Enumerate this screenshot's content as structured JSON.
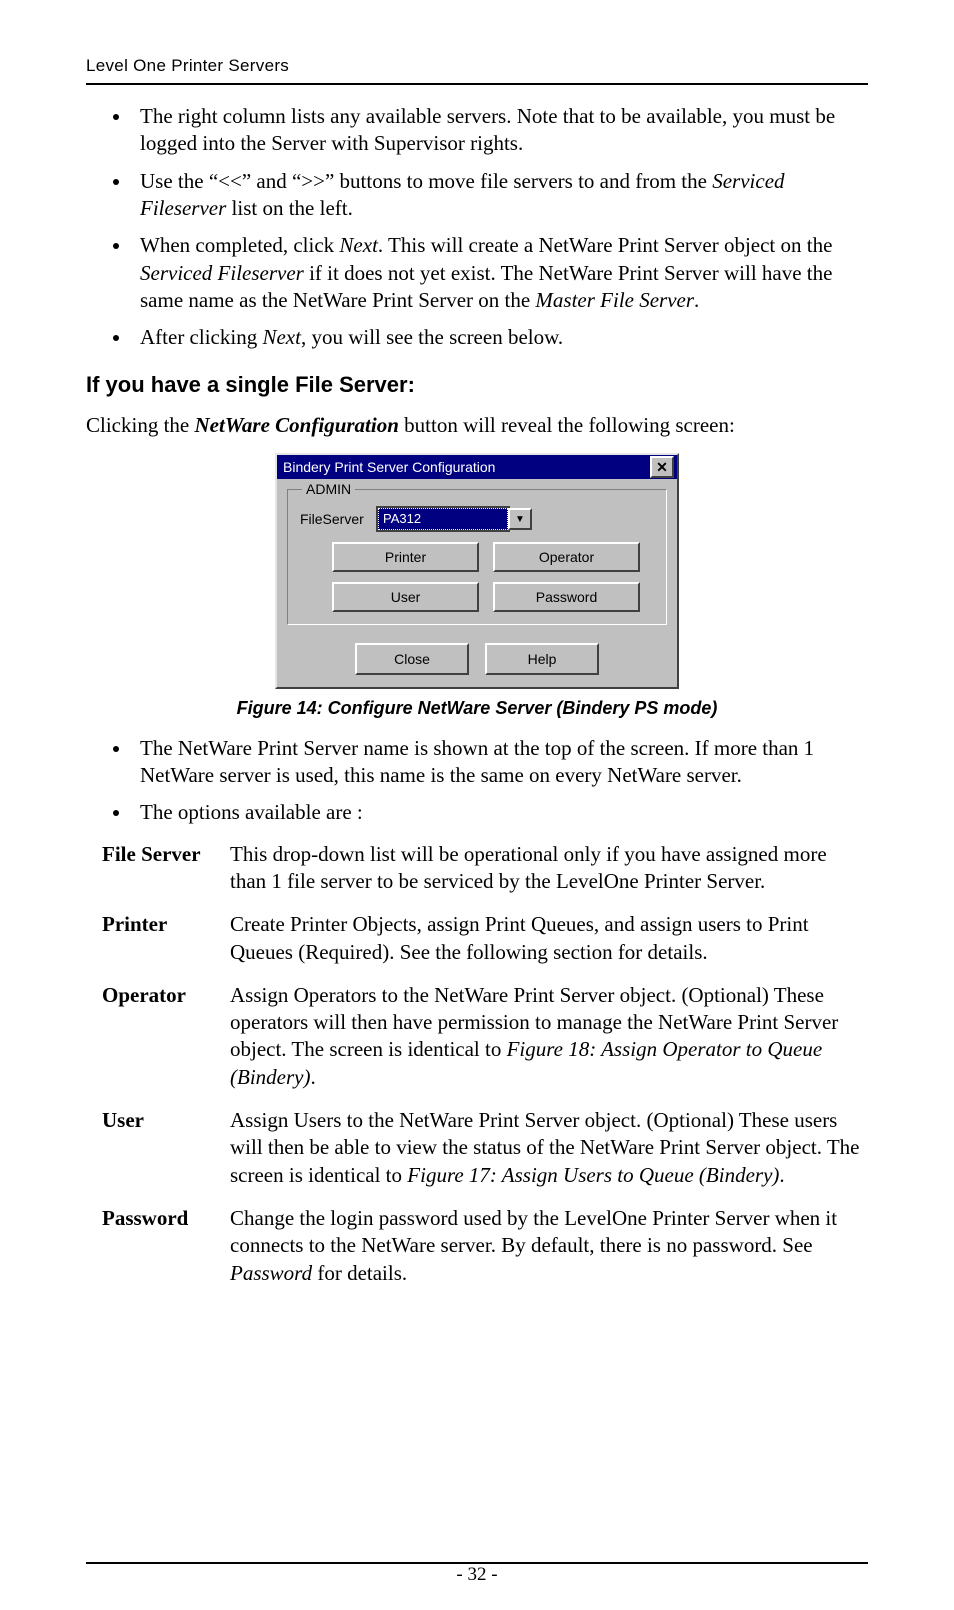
{
  "header": {
    "running_head": "Level One Printer Servers"
  },
  "bullets_top": [
    {
      "pre": "The right column lists any available servers. Note that to be available, you must be logged into the Server with Supervisor rights."
    },
    {
      "pre": "Use the “<<” and “>>” buttons to move file servers to and from the ",
      "em1": "Serviced Fileserver",
      "post1": " list on the left."
    },
    {
      "pre": "When completed, click ",
      "em1": "Next",
      "post1": ". This will create a NetWare Print Server object on the ",
      "em2": "Serviced Fileserver",
      "post2": " if it does not yet exist. The NetWare Print Server will have the same name as the NetWare Print Server on the ",
      "em3": "Master File Server",
      "post3": "."
    },
    {
      "pre": "After clicking ",
      "em1": "Next",
      "post1": ", you will see the screen below."
    }
  ],
  "section_heading": "If you have a single File Server:",
  "intro_para": {
    "pre": "Clicking the ",
    "bold_em": "NetWare Configuration",
    "post": " button will reveal the following screen:"
  },
  "dialog": {
    "title": "Bindery Print Server Configuration",
    "group_legend": "ADMIN",
    "fileserver_label": "FileServer",
    "fileserver_value": "PA312",
    "btn_printer": "Printer",
    "btn_operator": "Operator",
    "btn_user": "User",
    "btn_password": "Password",
    "btn_close": "Close",
    "btn_help": "Help"
  },
  "figure_caption": "Figure 14: Configure NetWare Server (Bindery PS mode)",
  "bullets_mid": [
    "The NetWare Print Server name is shown at the top of the screen. If more than 1 NetWare server is used, this name is the same on every NetWare server.",
    "The options available are :"
  ],
  "defs": [
    {
      "term": "File Server",
      "pre": "This drop-down list will be operational only if you have assigned more than 1 file server to be serviced by the LevelOne Printer Server."
    },
    {
      "term": "Printer",
      "pre": "Create Printer Objects, assign Print Queues, and assign users to Print Queues (Required). See the following section for details."
    },
    {
      "term": "Operator",
      "pre": "Assign Operators to the NetWare Print Server object. (Optional) These operators will then have permission to manage the NetWare Print Server object. The screen is identical to ",
      "em1": "Figure 18: Assign Operator to Queue (Bindery)",
      "post1": "."
    },
    {
      "term": "User",
      "pre": "Assign Users to the NetWare Print Server object. (Optional) These users will then be able to view the status of the NetWare Print Server object. The screen is identical to ",
      "em1": "Figure 17: Assign Users to Queue (Bindery)",
      "post1": "."
    },
    {
      "term": "Password",
      "pre": "Change the login password used by the LevelOne Printer Server when it connects to the NetWare server. By default, there is no password. See ",
      "em1": "Password",
      "post1": " for details."
    }
  ],
  "page_number": "- 32 -"
}
